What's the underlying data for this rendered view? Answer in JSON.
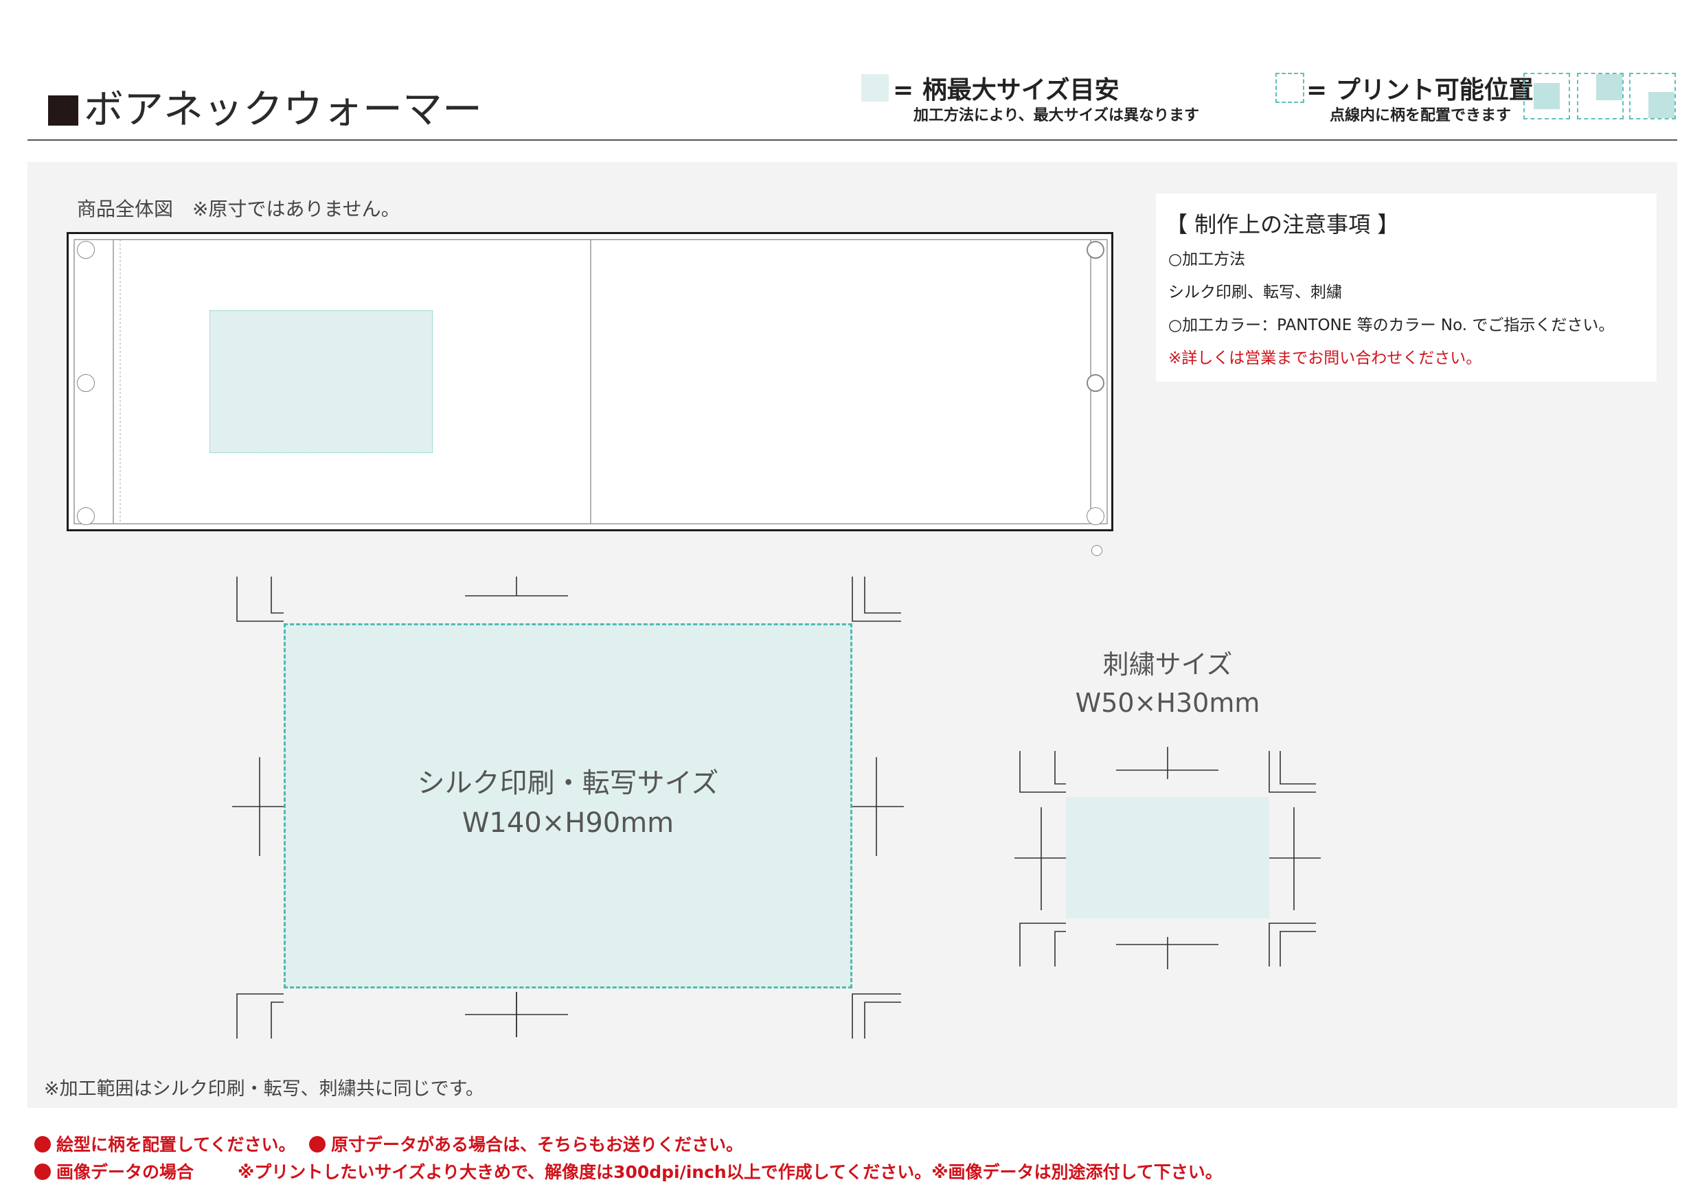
{
  "header": {
    "title": "ボアネックウォーマー",
    "legend_max": {
      "label": "= 柄最大サイズ目安",
      "note": "加工方法により、最大サイズは異なります"
    },
    "legend_printable": {
      "label": "= プリント可能位置",
      "note": "点線内に柄を配置できます"
    }
  },
  "overview": {
    "label": "商品全体図　※原寸ではありません。"
  },
  "notes": {
    "title": "【 制作上の注意事項 】",
    "method_heading": "○加工方法",
    "methods": "シルク印刷、転写、刺繍",
    "color_line": "○加工カラー：PANTONE 等のカラー No. でご指示ください。",
    "contact": "※詳しくは営業までお問い合わせください。"
  },
  "silk_area": {
    "name": "シルク印刷・転写サイズ",
    "size": "W140×H90mm"
  },
  "embroidery_area": {
    "name": "刺繍サイズ",
    "size": "W50×H30mm"
  },
  "footnote": "※加工範囲はシルク印刷・転写、刺繍共に同じです。",
  "warnings": {
    "w1": "絵型に柄を配置してください。",
    "w2": "原寸データがある場合は、そちらもお送りください。",
    "w3_head": "画像データの場合",
    "w3_body": "※プリントしたいサイズより大きめで、解像度は300dpi/inch以上で作成してください。※画像データは別途添付して下さい。"
  },
  "colors": {
    "area_fill": "#e0f0ee",
    "dash": "#4fbab3",
    "alert": "#d0121b"
  }
}
